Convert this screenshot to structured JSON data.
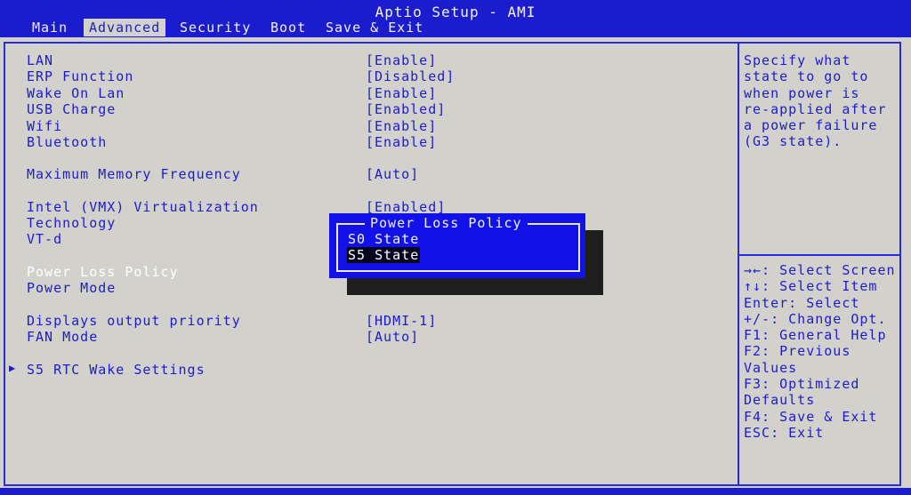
{
  "window": {
    "title": "Aptio Setup - AMI"
  },
  "tabs": [
    {
      "label": "Main",
      "active": false
    },
    {
      "label": "Advanced",
      "active": true
    },
    {
      "label": "Security",
      "active": false
    },
    {
      "label": "Boot",
      "active": false
    },
    {
      "label": "Save & Exit",
      "active": false
    }
  ],
  "settings": [
    {
      "label": "LAN",
      "value": "[Enable]"
    },
    {
      "label": "ERP Function",
      "value": "[Disabled]"
    },
    {
      "label": "Wake On Lan",
      "value": "[Enable]"
    },
    {
      "label": "USB Charge",
      "value": "[Enabled]"
    },
    {
      "label": "Wifi",
      "value": "[Enable]"
    },
    {
      "label": "Bluetooth",
      "value": "[Enable]"
    },
    {
      "label": "Maximum Memory Frequency",
      "value": "[Auto]"
    },
    {
      "label": "Intel (VMX) Virtualization",
      "value": "[Enabled]"
    },
    {
      "label": "Technology",
      "value": ""
    },
    {
      "label": "VT-d",
      "value": ""
    },
    {
      "label": "Power Loss Policy",
      "value": ""
    },
    {
      "label": "Power Mode",
      "value": ""
    },
    {
      "label": "Displays output priority",
      "value": "[HDMI-1]"
    },
    {
      "label": "FAN Mode",
      "value": "[Auto]"
    },
    {
      "label": "S5 RTC Wake Settings",
      "value": ""
    }
  ],
  "help": {
    "description": "Specify what\nstate to go to\nwhen power is\nre-applied after\na power failure\n(G3 state).",
    "keys": [
      "→←: Select Screen",
      "↑↓: Select Item",
      "Enter: Select",
      "+/-: Change Opt.",
      "F1: General Help",
      "F2: Previous",
      "Values",
      "F3: Optimized",
      "Defaults",
      "F4: Save & Exit",
      "ESC: Exit"
    ]
  },
  "popup": {
    "title": "Power Loss Policy",
    "options": [
      "S0 State",
      "S5 State"
    ],
    "selected_index": 1
  },
  "icons": {
    "submenu": "submenu-arrow-icon"
  },
  "colors": {
    "accent": "#1c1ccf",
    "background": "#d2d1cc",
    "popup": "#1111e8",
    "selected_text": "#ffffff"
  }
}
